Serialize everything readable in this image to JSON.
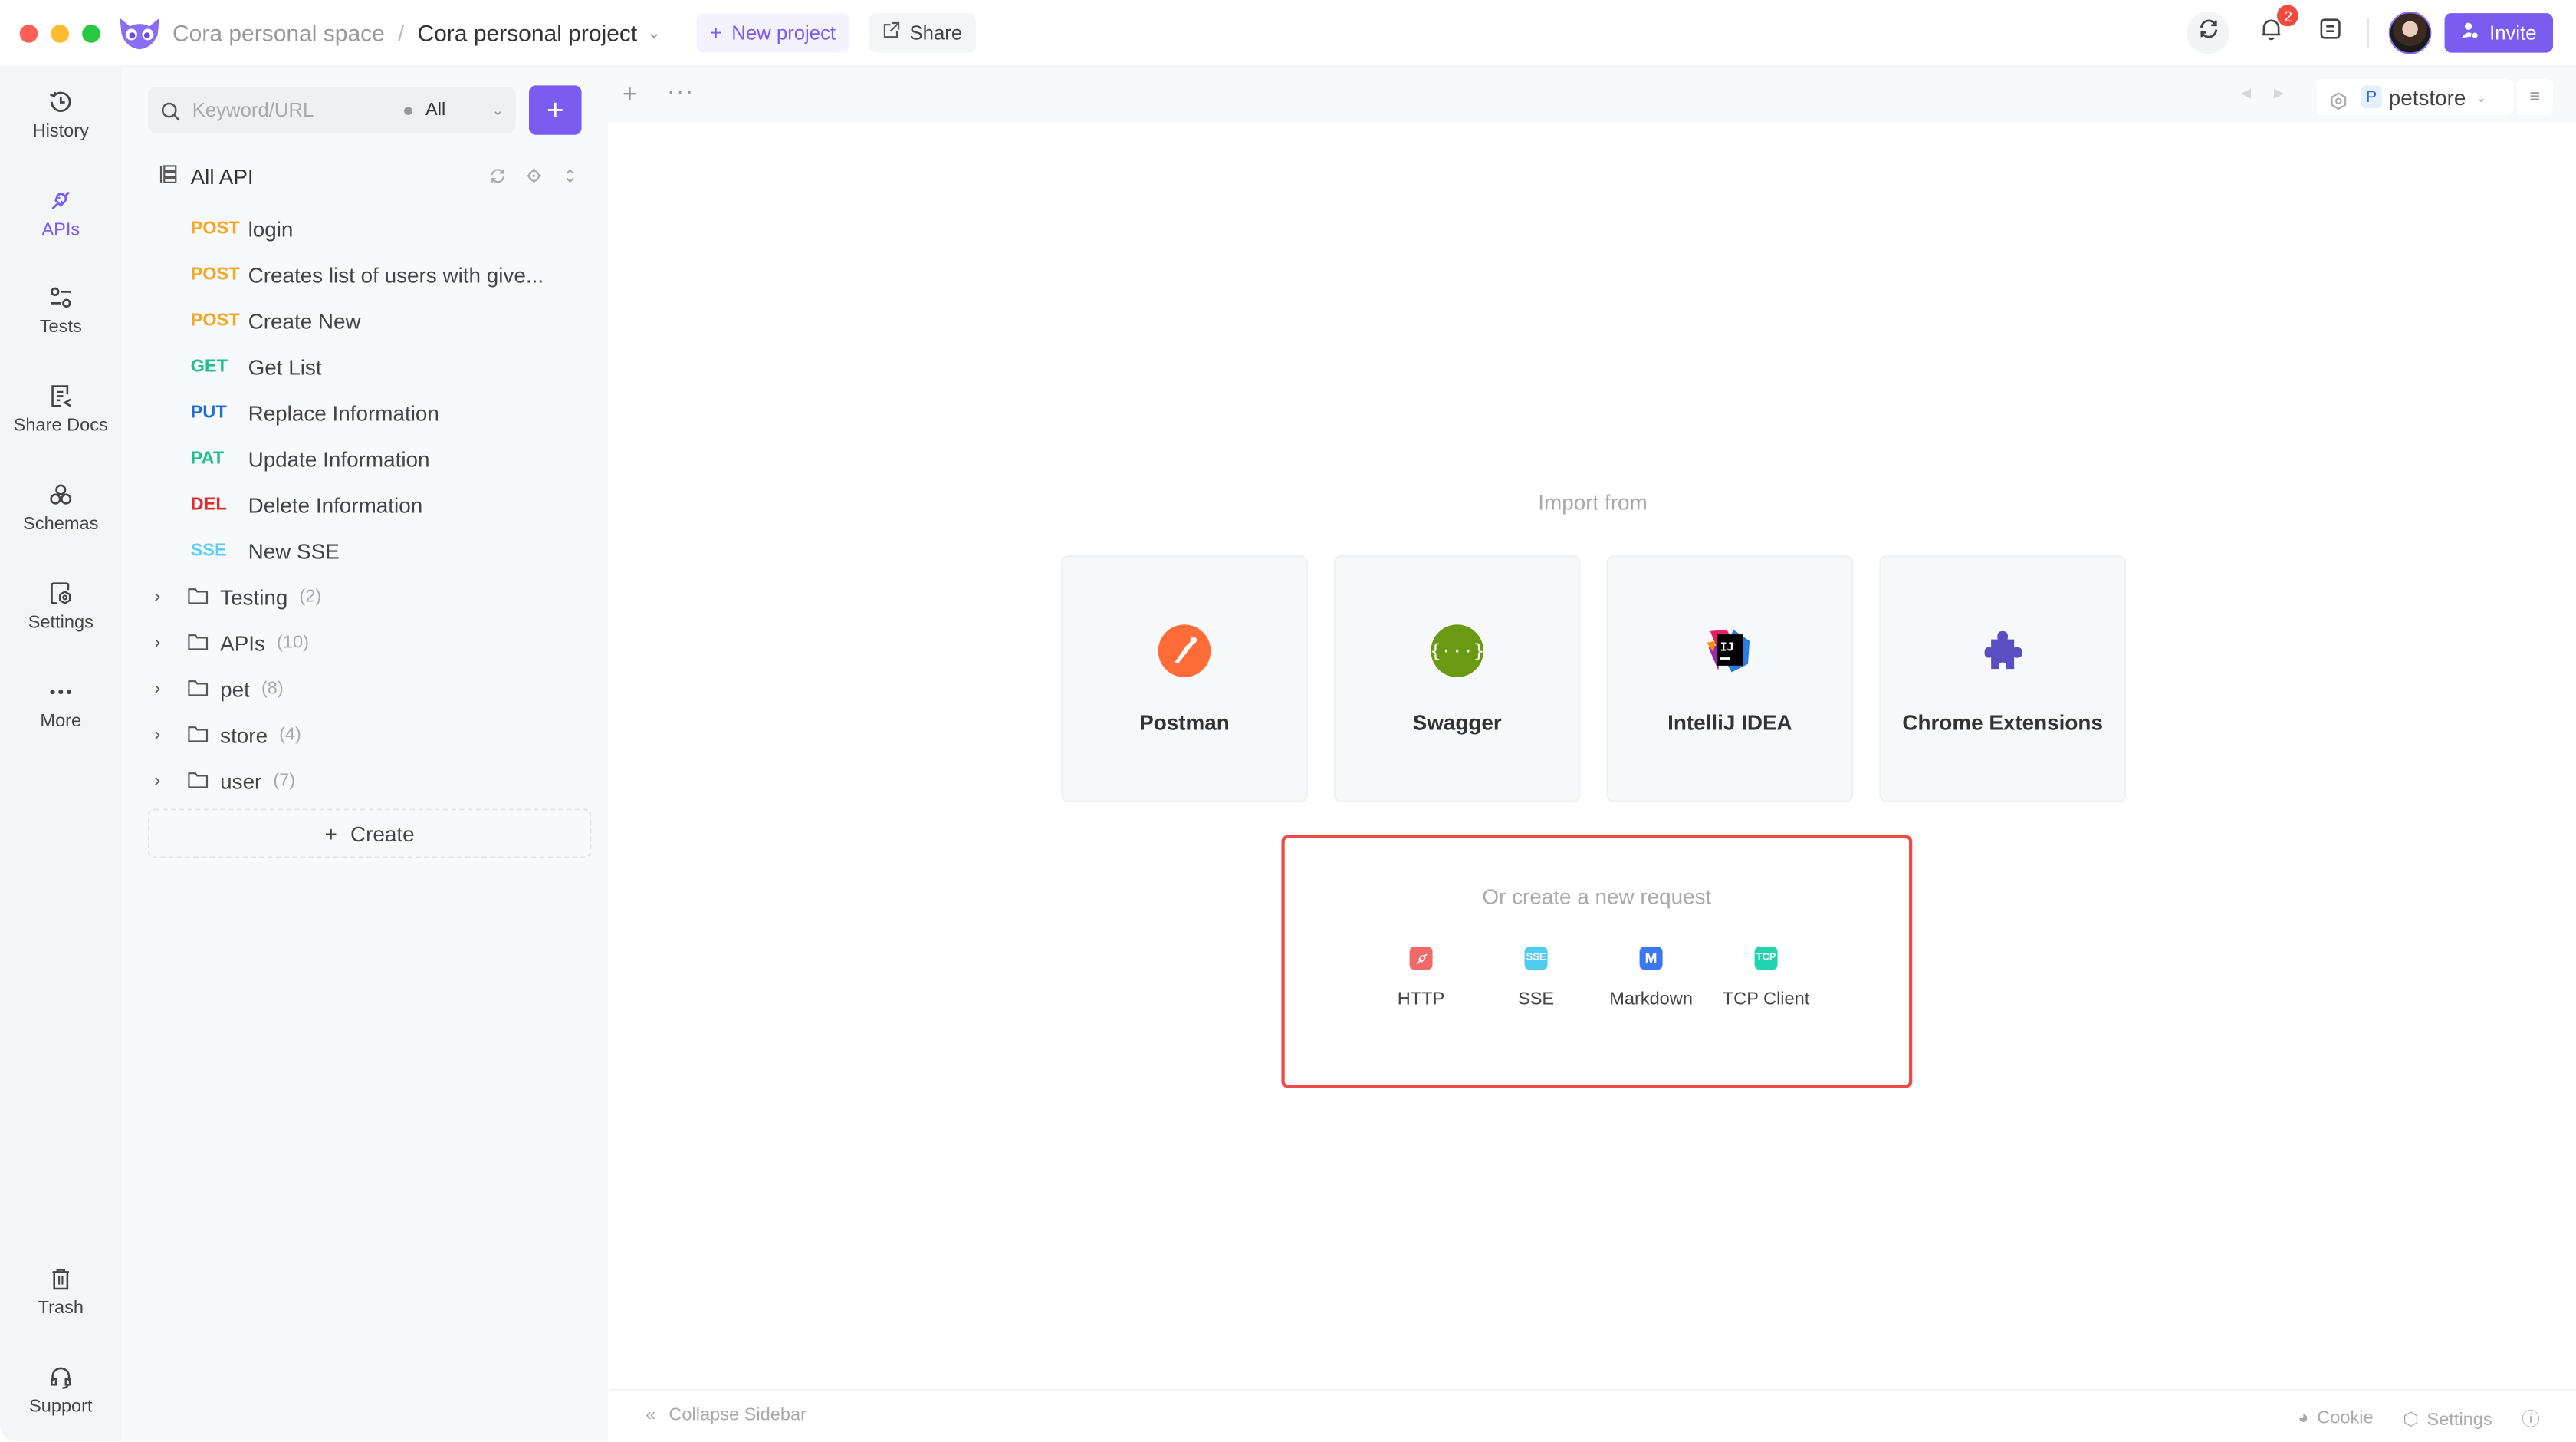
{
  "titlebar": {
    "space": "Cora personal space",
    "separator": "/",
    "project": "Cora personal project",
    "new_project": "New project",
    "share": "Share",
    "notification_count": "2",
    "invite": "Invite"
  },
  "rail": {
    "items": [
      {
        "label": "History",
        "icon": "history-icon"
      },
      {
        "label": "APIs",
        "icon": "plug-icon",
        "active": true
      },
      {
        "label": "Tests",
        "icon": "sliders-icon"
      },
      {
        "label": "Share Docs",
        "icon": "share-docs-icon"
      },
      {
        "label": "Schemas",
        "icon": "schemas-icon"
      },
      {
        "label": "Settings",
        "icon": "settings-icon"
      },
      {
        "label": "More",
        "icon": "more-icon"
      }
    ],
    "bottom": [
      {
        "label": "Trash",
        "icon": "trash-icon"
      },
      {
        "label": "Support",
        "icon": "headset-icon"
      }
    ]
  },
  "api_panel": {
    "search_placeholder": "Keyword/URL",
    "filter": "All",
    "root_label": "All API",
    "requests": [
      {
        "method": "POST",
        "name": "login",
        "color": "#f5a623"
      },
      {
        "method": "POST",
        "name": "Creates list of users with give...",
        "color": "#f5a623"
      },
      {
        "method": "POST",
        "name": "Create New",
        "color": "#f5a623"
      },
      {
        "method": "GET",
        "name": "Get List",
        "color": "#1fbf8f"
      },
      {
        "method": "PUT",
        "name": "Replace Information",
        "color": "#1f6fd6"
      },
      {
        "method": "PAT",
        "name": "Update Information",
        "color": "#1fbf8f"
      },
      {
        "method": "DEL",
        "name": "Delete Information",
        "color": "#e02b2b"
      },
      {
        "method": "SSE",
        "name": "New SSE",
        "color": "#5ccff2"
      }
    ],
    "folders": [
      {
        "name": "Testing",
        "count": "(2)"
      },
      {
        "name": "APIs",
        "count": "(10)"
      },
      {
        "name": "pet",
        "count": "(8)"
      },
      {
        "name": "store",
        "count": "(4)"
      },
      {
        "name": "user",
        "count": "(7)"
      }
    ],
    "create_label": "Create"
  },
  "tabbar": {
    "environment_badge": "P",
    "environment": "petstore"
  },
  "main": {
    "import_label": "Import from",
    "import_sources": [
      {
        "label": "Postman",
        "icon": "postman-icon"
      },
      {
        "label": "Swagger",
        "icon": "swagger-icon"
      },
      {
        "label": "IntelliJ IDEA",
        "icon": "intellij-icon"
      },
      {
        "label": "Chrome Extensions",
        "icon": "puzzle-icon"
      }
    ],
    "new_request_label": "Or create a new request",
    "request_types": [
      {
        "label": "HTTP",
        "badge": "",
        "color": "#f06a6a"
      },
      {
        "label": "SSE",
        "badge": "SSE",
        "color": "#4fcdf0"
      },
      {
        "label": "Markdown",
        "badge": "M",
        "color": "#3a78f0"
      },
      {
        "label": "TCP Client",
        "badge": "TCP",
        "color": "#22d3b0"
      }
    ]
  },
  "bottombar": {
    "collapse": "Collapse Sidebar",
    "cookie": "Cookie",
    "settings": "Settings"
  },
  "colors": {
    "accent": "#7b5cf0",
    "highlight_border": "#ef4a4a"
  }
}
